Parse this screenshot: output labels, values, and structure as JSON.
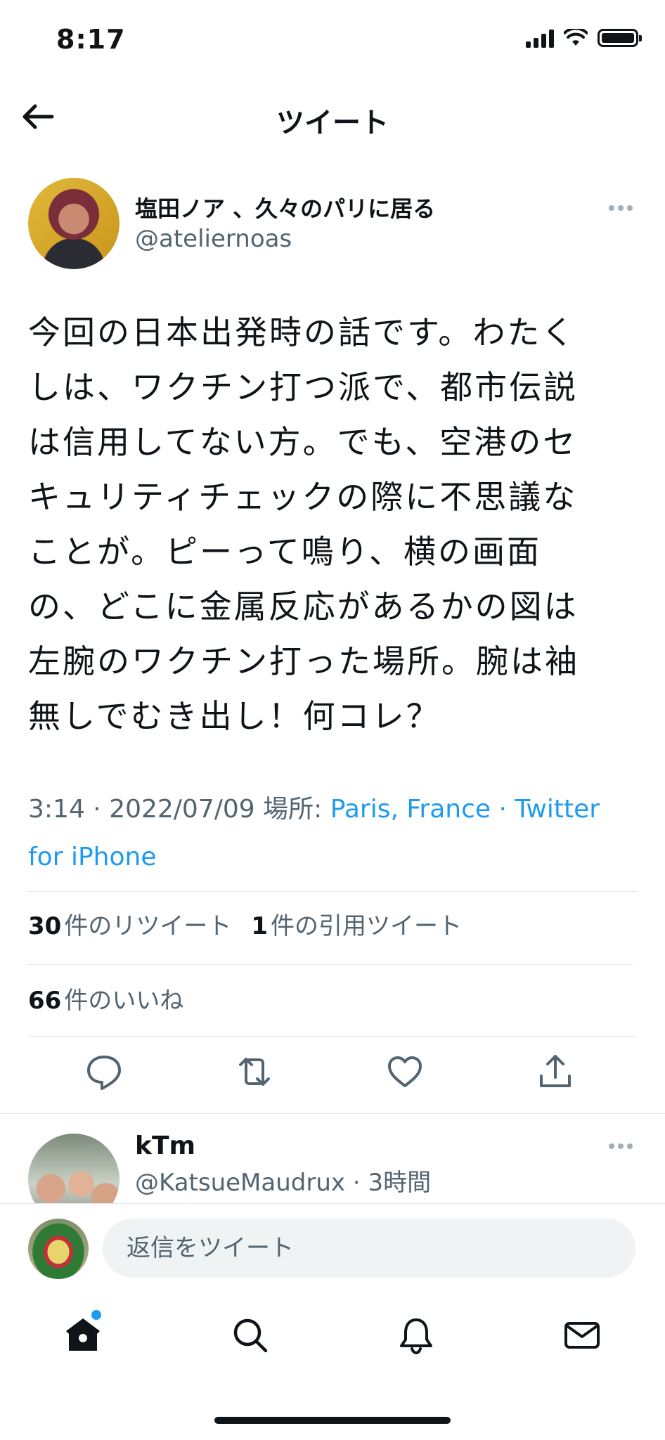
{
  "status_bar": {
    "time": "8:17"
  },
  "header": {
    "title": "ツイート"
  },
  "tweet": {
    "author_name": "塩田ノア 、久々のパリに居る",
    "author_handle": "@ateliernoas",
    "text_lines": [
      "今回の日本出発時の話です。わたく",
      "しは、ワクチン打つ派で、都市伝説",
      "は信用してない方。でも、空港のセ",
      "キュリティチェックの際に不思議な",
      "ことが。ピーって鳴り、横の画面",
      "の、どこに金属反応があるかの図は",
      "左腕のワクチン打った場所。腕は袖",
      "無しでむき出し！何コレ？"
    ],
    "time": "3:14",
    "date": "2022/07/09",
    "location_label": "場所:",
    "location": "Paris, France",
    "source": "Twitter for iPhone",
    "retweets_count": "30",
    "retweets_label": "件のリツイート",
    "quotes_count": "1",
    "quotes_label": "件の引用ツイート",
    "likes_count": "66",
    "likes_label": "件のいいね"
  },
  "reply": {
    "name": "kTm",
    "handle": "@KatsueMaudrux",
    "time_ago": "3時間"
  },
  "composer": {
    "placeholder": "返信をツイート"
  },
  "icons": {
    "back": "arrow-left-icon",
    "more": "more-horizontal-icon",
    "reply": "comment-icon",
    "retweet": "retweet-icon",
    "like": "heart-icon",
    "share": "share-icon",
    "home": "home-icon",
    "search": "search-icon",
    "notifications": "bell-icon",
    "messages": "envelope-icon"
  },
  "colors": {
    "accent": "#1d9bf0",
    "secondary_text": "#536471"
  }
}
